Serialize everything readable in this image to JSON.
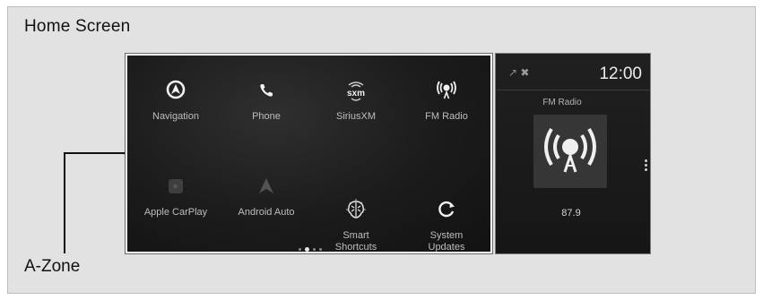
{
  "caption": "Home Screen",
  "zone_label": "A-Zone",
  "apps": [
    {
      "label": "Navigation",
      "icon": "navigation-icon"
    },
    {
      "label": "Phone",
      "icon": "phone-icon"
    },
    {
      "label": "SiriusXM",
      "icon": "siriusxm-icon",
      "icon_text": "sxm"
    },
    {
      "label": "FM Radio",
      "icon": "radio-broadcast-icon"
    },
    {
      "label": "Apple CarPlay",
      "icon": "carplay-icon"
    },
    {
      "label": "Android Auto",
      "icon": "android-auto-icon"
    },
    {
      "label": "Smart\nShortcuts",
      "icon": "brain-icon"
    },
    {
      "label": "System\nUpdates",
      "icon": "refresh-icon"
    }
  ],
  "pager": {
    "count": 3,
    "active": 1
  },
  "side_panel": {
    "clock": "12:00",
    "source_title": "FM Radio",
    "frequency": "87.9",
    "status_icons": [
      "signal-icon",
      "no-gps-icon"
    ]
  }
}
